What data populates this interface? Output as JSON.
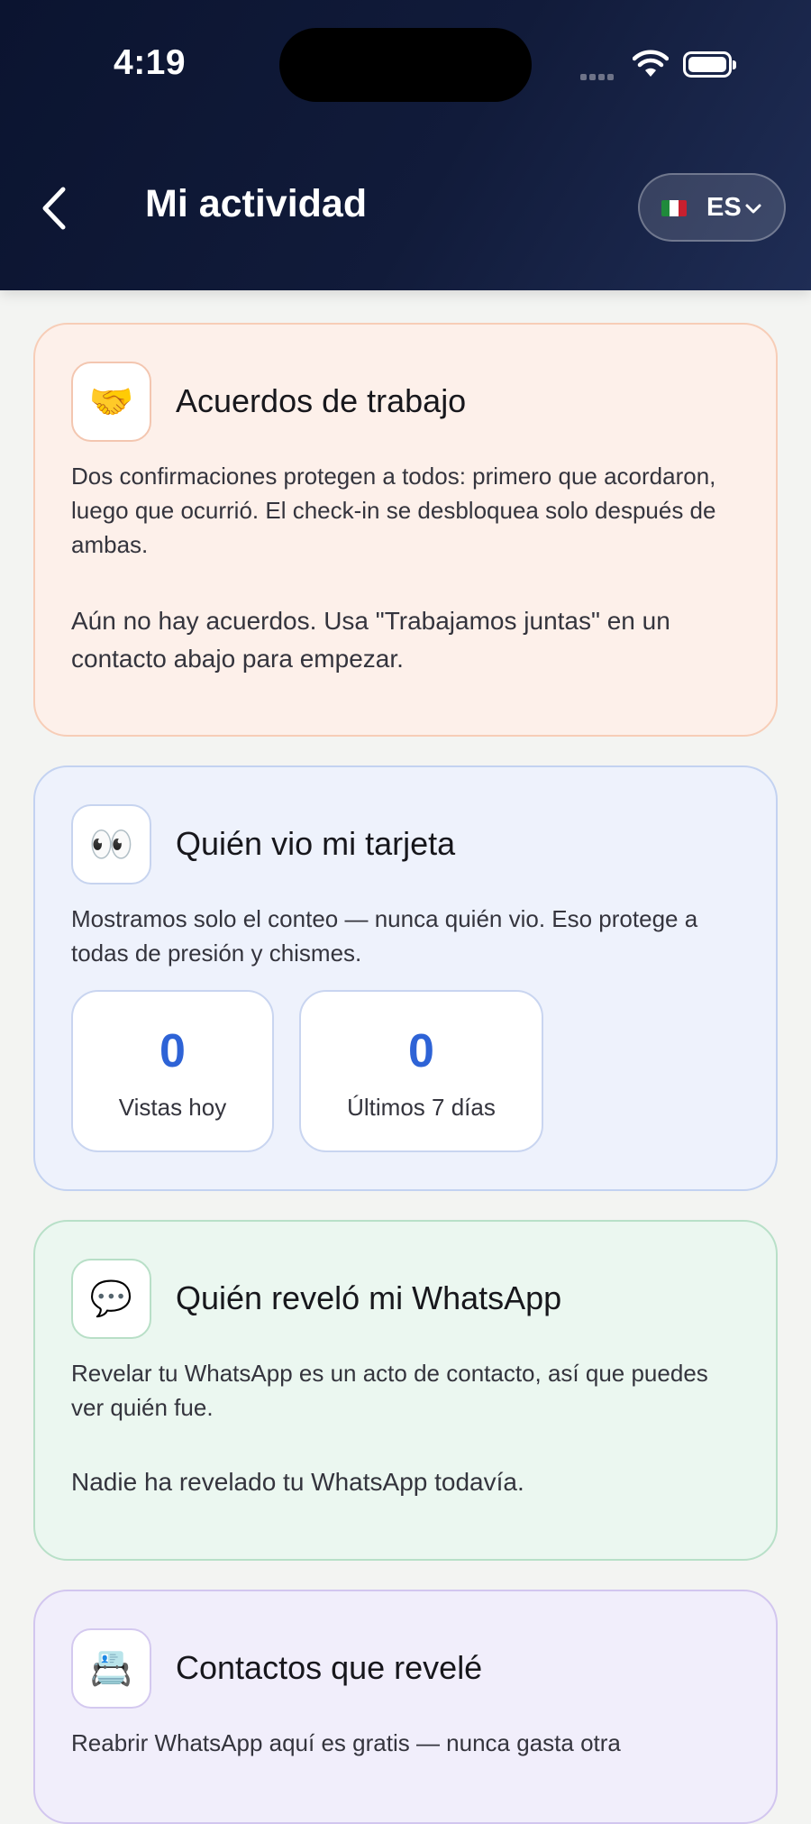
{
  "status_bar": {
    "time": "4:19"
  },
  "header": {
    "title": "Mi actividad",
    "language": {
      "code": "ES",
      "flag": "mx-flag-icon"
    }
  },
  "cards": [
    {
      "icon": "handshake-icon",
      "icon_glyph": "🤝",
      "title": "Acuerdos de trabajo",
      "description": "Dos confirmaciones protegen a todos: primero que acordaron, luego que ocurrió. El check-in se desbloquea solo después de ambas.",
      "empty_text": "Aún no hay acuerdos. Usa \"Trabajamos juntas\" en un contacto abajo para empezar."
    },
    {
      "icon": "eyes-icon",
      "icon_glyph": "👀",
      "title": "Quién vio mi tarjeta",
      "description": "Mostramos solo el conteo — nunca quién vio. Eso protege a todas de presión y chismes.",
      "stats": [
        {
          "value": "0",
          "label": "Vistas hoy"
        },
        {
          "value": "0",
          "label": "Últimos 7 días"
        }
      ]
    },
    {
      "icon": "speech-bubble-icon",
      "icon_glyph": "💬",
      "title": "Quién reveló mi WhatsApp",
      "description": "Revelar tu WhatsApp es un acto de contacto, así que puedes ver quién fue.",
      "empty_text": "Nadie ha revelado tu WhatsApp todavía."
    },
    {
      "icon": "card-index-icon",
      "icon_glyph": "📇",
      "title": "Contactos que revelé",
      "description": "Reabrir WhatsApp aquí es gratis — nunca gasta otra"
    }
  ],
  "colors": {
    "header_bg": "#0f1a38",
    "accent_blue": "#2e63d6",
    "card_orange_bg": "#fdf0ea",
    "card_blue_bg": "#eef2fc",
    "card_green_bg": "#ebf7f0",
    "card_purple_bg": "#f1eefb"
  }
}
